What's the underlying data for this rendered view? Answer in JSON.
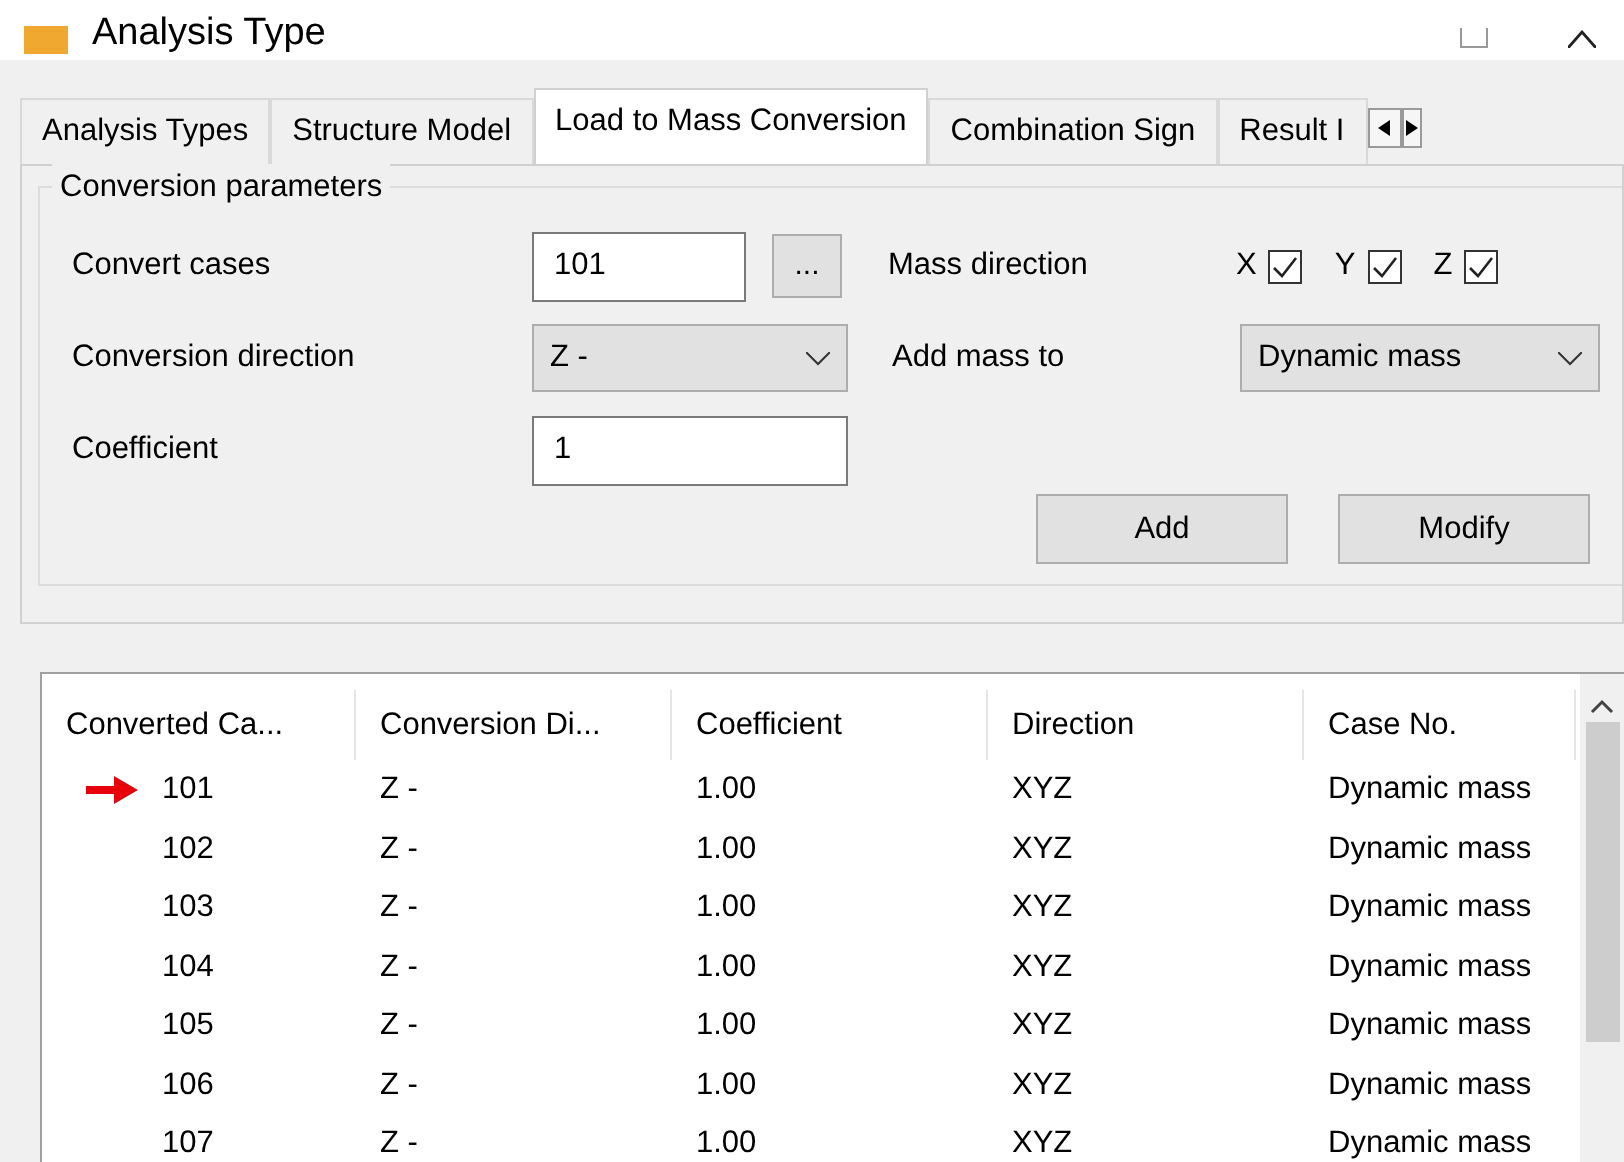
{
  "window": {
    "title": "Analysis Type"
  },
  "tabs": [
    {
      "label": "Analysis Types",
      "selected": false
    },
    {
      "label": "Structure Model",
      "selected": false
    },
    {
      "label": "Load to Mass Conversion",
      "selected": true
    },
    {
      "label": "Combination Sign",
      "selected": false
    },
    {
      "label": "Result I",
      "selected": false
    }
  ],
  "group": {
    "title": "Conversion parameters",
    "convert_cases": {
      "label": "Convert cases",
      "value": "101",
      "browse": "..."
    },
    "mass_direction": {
      "label": "Mass direction",
      "axes": [
        {
          "label": "X",
          "checked": true
        },
        {
          "label": "Y",
          "checked": true
        },
        {
          "label": "Z",
          "checked": true
        }
      ]
    },
    "conversion_direction": {
      "label": "Conversion direction",
      "value": "Z -"
    },
    "add_mass_to": {
      "label": "Add mass to",
      "value": "Dynamic mass"
    },
    "coefficient": {
      "label": "Coefficient",
      "value": "1"
    },
    "buttons": [
      "Add",
      "Modify"
    ]
  },
  "table": {
    "columns": [
      "Converted Ca...",
      "Conversion Di...",
      "Coefficient",
      "Direction",
      "Case No."
    ],
    "rows": [
      {
        "current": true,
        "cells": [
          "101",
          "Z -",
          "1.00",
          "XYZ",
          "Dynamic mass"
        ]
      },
      {
        "current": false,
        "cells": [
          "102",
          "Z -",
          "1.00",
          "XYZ",
          "Dynamic mass"
        ]
      },
      {
        "current": false,
        "cells": [
          "103",
          "Z -",
          "1.00",
          "XYZ",
          "Dynamic mass"
        ]
      },
      {
        "current": false,
        "cells": [
          "104",
          "Z -",
          "1.00",
          "XYZ",
          "Dynamic mass"
        ]
      },
      {
        "current": false,
        "cells": [
          "105",
          "Z -",
          "1.00",
          "XYZ",
          "Dynamic mass"
        ]
      },
      {
        "current": false,
        "cells": [
          "106",
          "Z -",
          "1.00",
          "XYZ",
          "Dynamic mass"
        ]
      },
      {
        "current": false,
        "cells": [
          "107",
          "Z -",
          "1.00",
          "XYZ",
          "Dynamic mass"
        ]
      }
    ]
  }
}
